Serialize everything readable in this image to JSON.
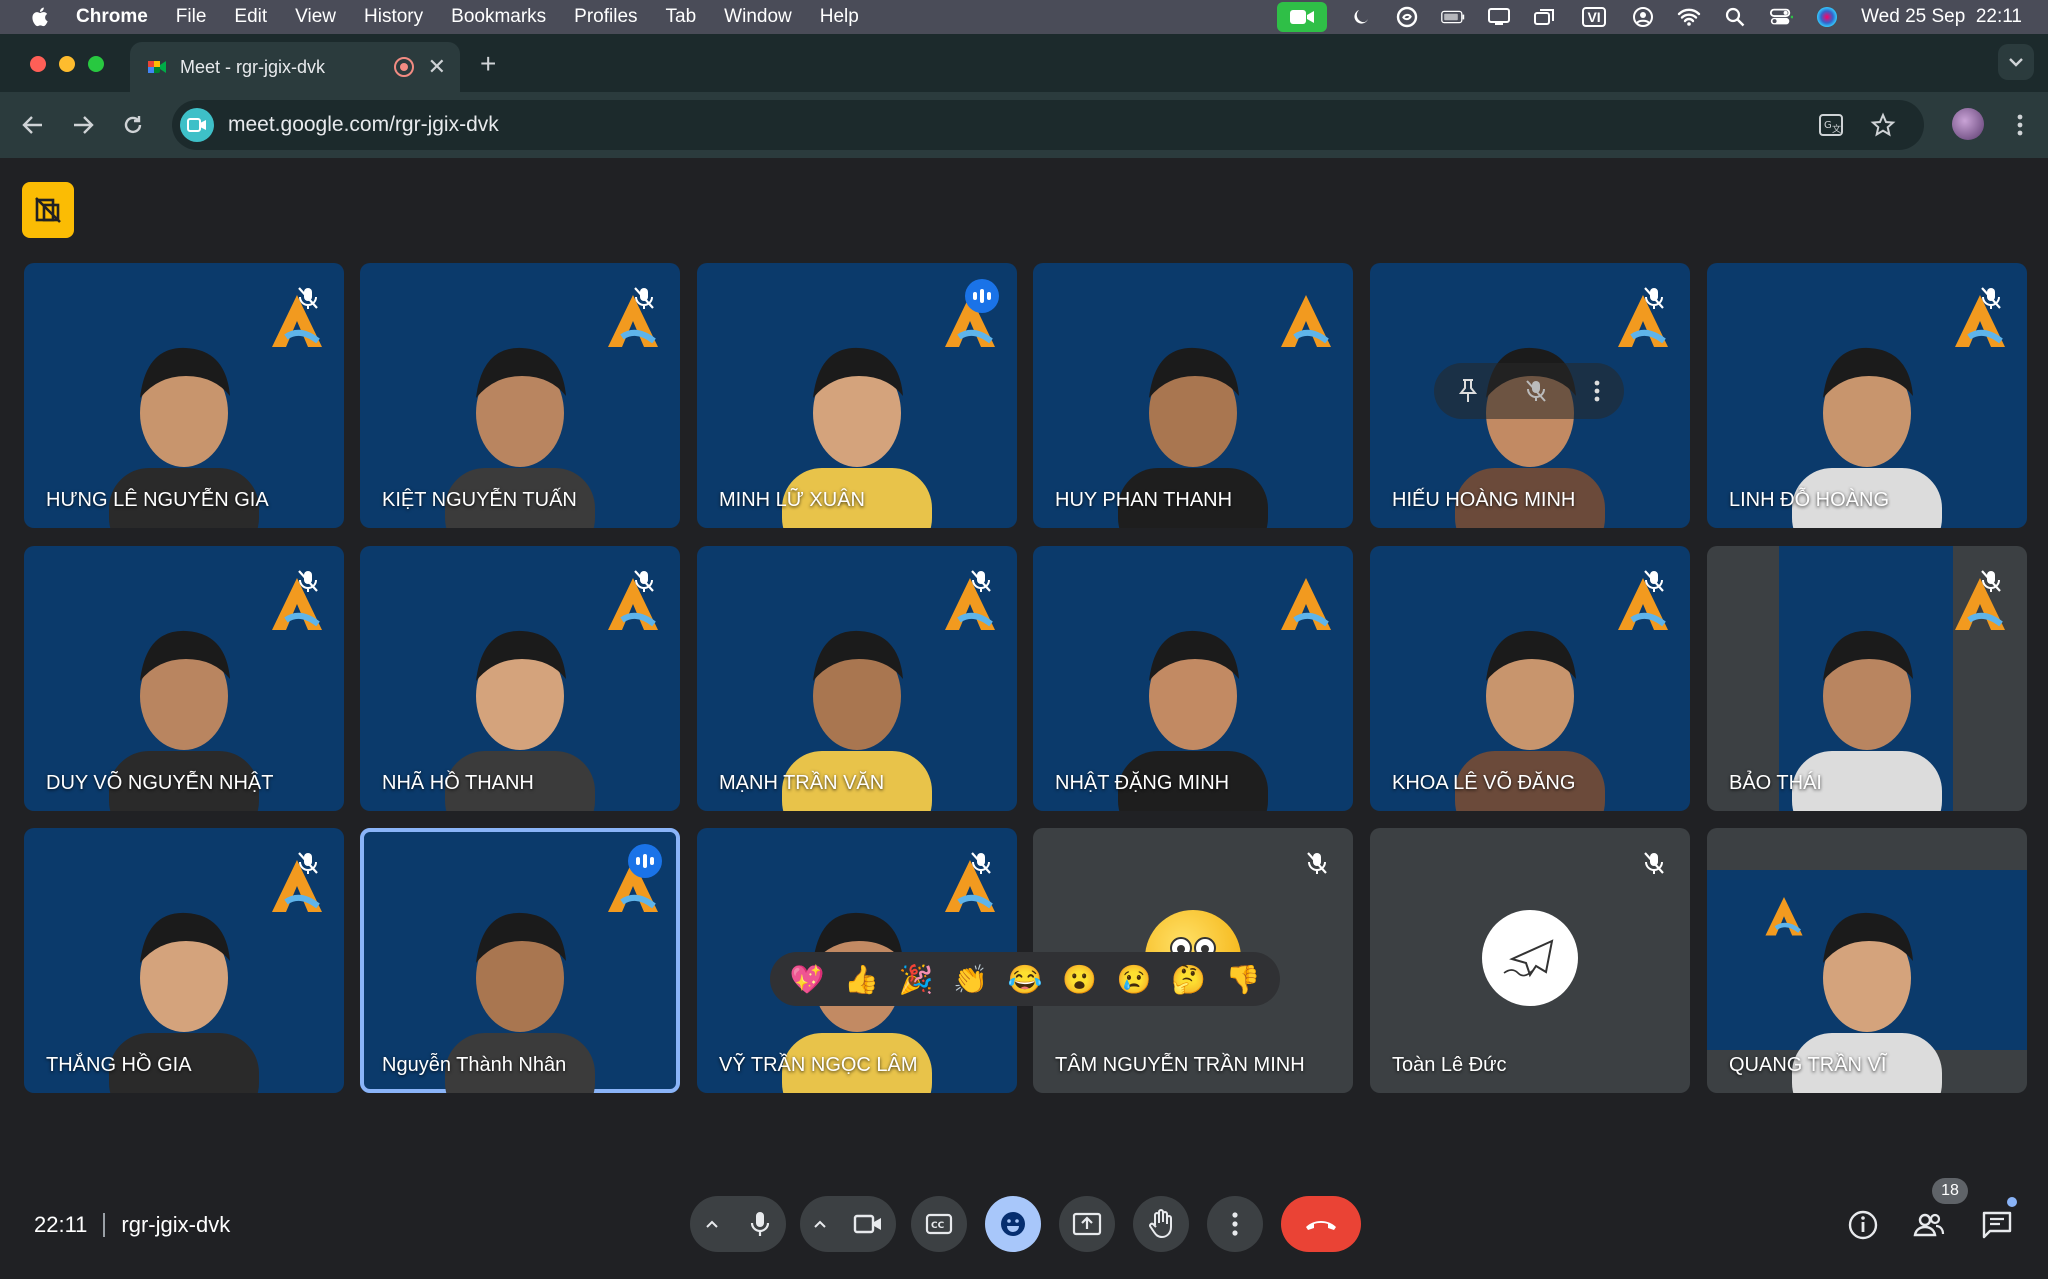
{
  "menubar": {
    "app": "Chrome",
    "items": [
      "File",
      "Edit",
      "View",
      "History",
      "Bookmarks",
      "Profiles",
      "Tab",
      "Window",
      "Help"
    ],
    "input_source": "VI",
    "clock": "Wed 25 Sep  22:11"
  },
  "browser": {
    "tab_title": "Meet - rgr-jgix-dvk",
    "url": "meet.google.com/rgr-jgix-dvk"
  },
  "colors": {
    "accent": "#8ab4f8",
    "tile_background": "#0b3a6b",
    "hangup": "#ea4335",
    "badge": "#fbbc04"
  },
  "participants": [
    {
      "name": "HƯNG LÊ NGUYỄN GIA",
      "status": "muted"
    },
    {
      "name": "KIỆT NGUYỄN TUẤN",
      "status": "muted"
    },
    {
      "name": "MINH LỮ XUÂN",
      "status": "speaking"
    },
    {
      "name": "HUY PHAN THANH",
      "status": ""
    },
    {
      "name": "HIẾU HOÀNG MINH",
      "status": "muted"
    },
    {
      "name": "LINH ĐỖ HOÀNG",
      "status": "muted"
    },
    {
      "name": "DUY VÕ NGUYỄN NHẬT",
      "status": "muted"
    },
    {
      "name": "NHÃ HỒ THANH",
      "status": "muted"
    },
    {
      "name": "MẠNH TRẦN VĂN",
      "status": "muted"
    },
    {
      "name": "NHẬT ĐẶNG MINH",
      "status": ""
    },
    {
      "name": "KHOA LÊ VÕ ĐĂNG",
      "status": "muted"
    },
    {
      "name": "BẢO THÁI",
      "status": "muted"
    },
    {
      "name": "THẮNG HỒ GIA",
      "status": "muted"
    },
    {
      "name": "Nguyễn Thành Nhân",
      "status": "speaking"
    },
    {
      "name": "VỸ TRẦN NGỌC LÂM",
      "status": "muted"
    },
    {
      "name": "TÂM NGUYỄN TRẦN MINH",
      "status": "muted"
    },
    {
      "name": "Toàn Lê Đức",
      "status": "muted"
    },
    {
      "name": "QUANG TRẦN VĨ",
      "status": ""
    }
  ],
  "reactions": [
    "💖",
    "👍",
    "🎉",
    "👏",
    "😂",
    "😮",
    "😢",
    "🤔",
    "👎"
  ],
  "meeting": {
    "time": "22:11",
    "code": "rgr-jgix-dvk",
    "participant_count": "18"
  }
}
